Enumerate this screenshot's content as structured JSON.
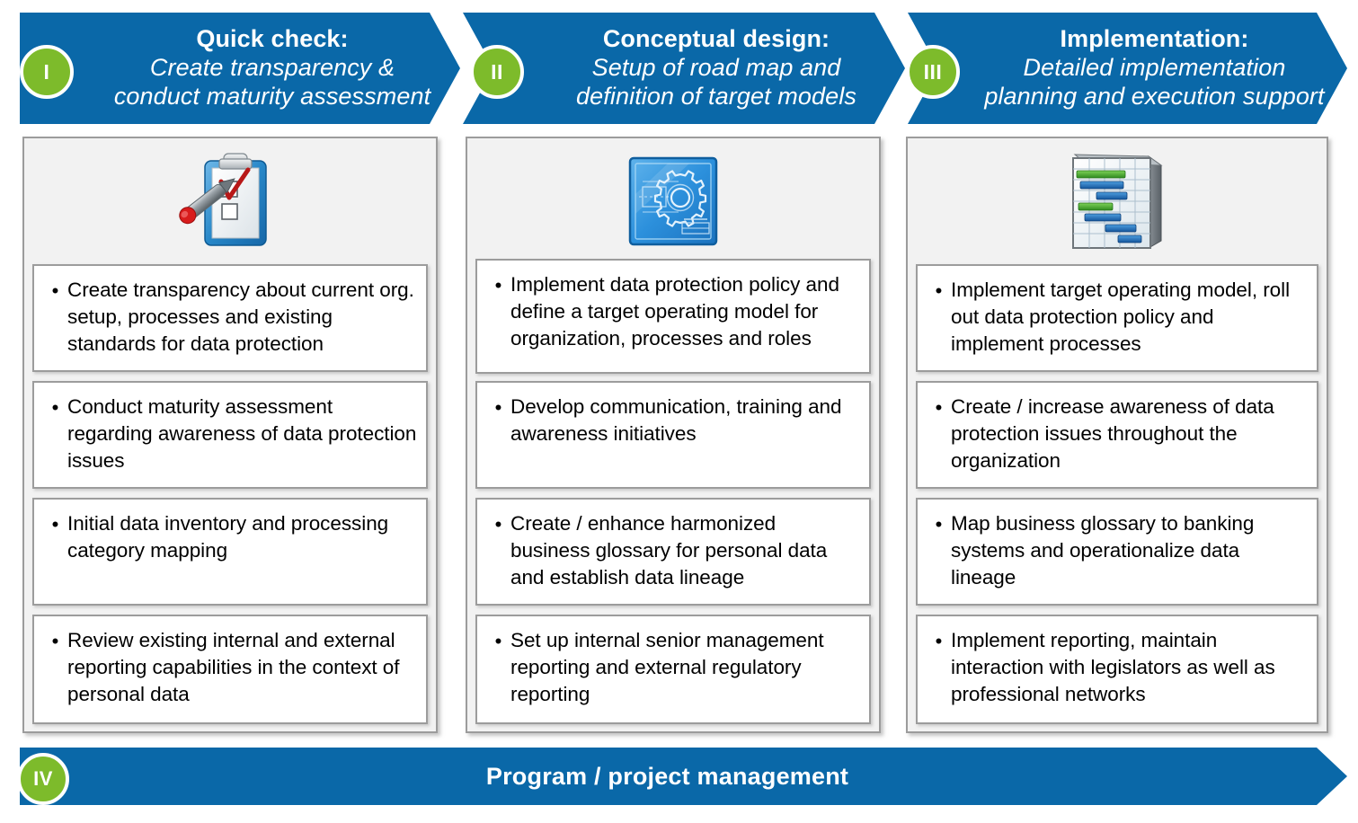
{
  "colors": {
    "brand_blue": "#0A68A8",
    "accent_green": "#7DBB2B",
    "card_bg": "#FFFFFF",
    "column_bg": "#F2F2F2",
    "border_gray": "#9C9C9C",
    "text_dark": "#000000",
    "text_light": "#FFFFFF"
  },
  "phases": [
    {
      "badge": "I",
      "title": "Quick check:",
      "subtitle": "Create transparency &\nconduct maturity assessment",
      "icon": "clipboard-checklist-icon",
      "items": [
        {
          "bullet": "•",
          "text": "Create transparency about current org. setup, processes and existing standards for data protection"
        },
        {
          "bullet": "•",
          "text": "Conduct maturity assessment regarding awareness of data protection issues"
        },
        {
          "bullet": "•",
          "text": "Initial data inventory and processing category mapping"
        },
        {
          "bullet": "•",
          "text": "Review existing internal and external reporting capabilities in the context of personal data"
        }
      ]
    },
    {
      "badge": "II",
      "title": "Conceptual design:",
      "subtitle": "Setup of road map and\ndefinition of target models",
      "icon": "blueprint-gear-icon",
      "items": [
        {
          "bullet": "•",
          "text": "Implement data protection policy and define a target operating model for organization, processes and roles"
        },
        {
          "bullet": "•",
          "text": "Develop communication, training and awareness initiatives"
        },
        {
          "bullet": "•",
          "text": "Create / enhance harmonized business glossary for personal data and establish data lineage"
        },
        {
          "bullet": "•",
          "text": "Set up internal senior management reporting and external regulatory reporting"
        }
      ]
    },
    {
      "badge": "III",
      "title": "Implementation:",
      "subtitle": "Detailed implementation\nplanning and execution support",
      "icon": "gantt-chart-icon",
      "items": [
        {
          "bullet": "•",
          "text": "Implement target operating model, roll out data protection policy and implement processes"
        },
        {
          "bullet": "•",
          "text": "Create / increase awareness of data protection issues throughout the organization"
        },
        {
          "bullet": "•",
          "text": "Map business glossary to banking systems and operationalize data lineage"
        },
        {
          "bullet": "•",
          "text": "Implement reporting, maintain interaction with legislators as well as professional networks"
        }
      ]
    }
  ],
  "footer": {
    "badge": "IV",
    "label": "Program / project management"
  }
}
